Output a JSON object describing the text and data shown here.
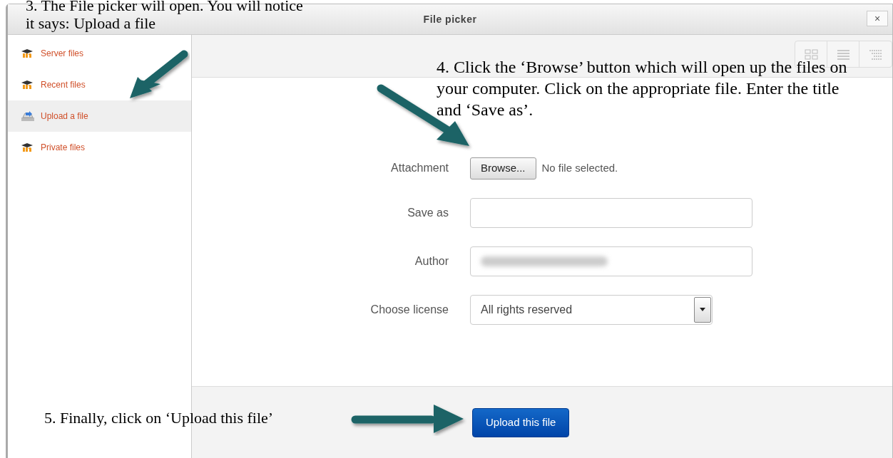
{
  "annotations": [
    {
      "text": "3. The File picker will open. You will notice"
    },
    {
      "text": "it says: Upload a file"
    },
    {
      "text": "4. Click the ‘Browse’ button which will open up the files on your computer. Click on the appropriate file. Enter the title and ‘Save as’."
    },
    {
      "text": "5. Finally, click on ‘Upload this file’"
    }
  ],
  "window": {
    "title": "File picker",
    "close": "×"
  },
  "sidebar": {
    "items": [
      {
        "label": "Server files",
        "kind": "repository",
        "selected": false
      },
      {
        "label": "Recent files",
        "kind": "repository",
        "selected": false
      },
      {
        "label": "Upload a file",
        "kind": "upload",
        "selected": true
      },
      {
        "label": "Private files",
        "kind": "repository",
        "selected": false
      }
    ]
  },
  "form": {
    "attachment": {
      "label": "Attachment",
      "button": "Browse...",
      "status": "No file selected."
    },
    "save_as": {
      "label": "Save as"
    },
    "author": {
      "label": "Author"
    },
    "license": {
      "label": "Choose license",
      "value": "All rights reserved"
    }
  },
  "footer": {
    "button": "Upload this file"
  }
}
